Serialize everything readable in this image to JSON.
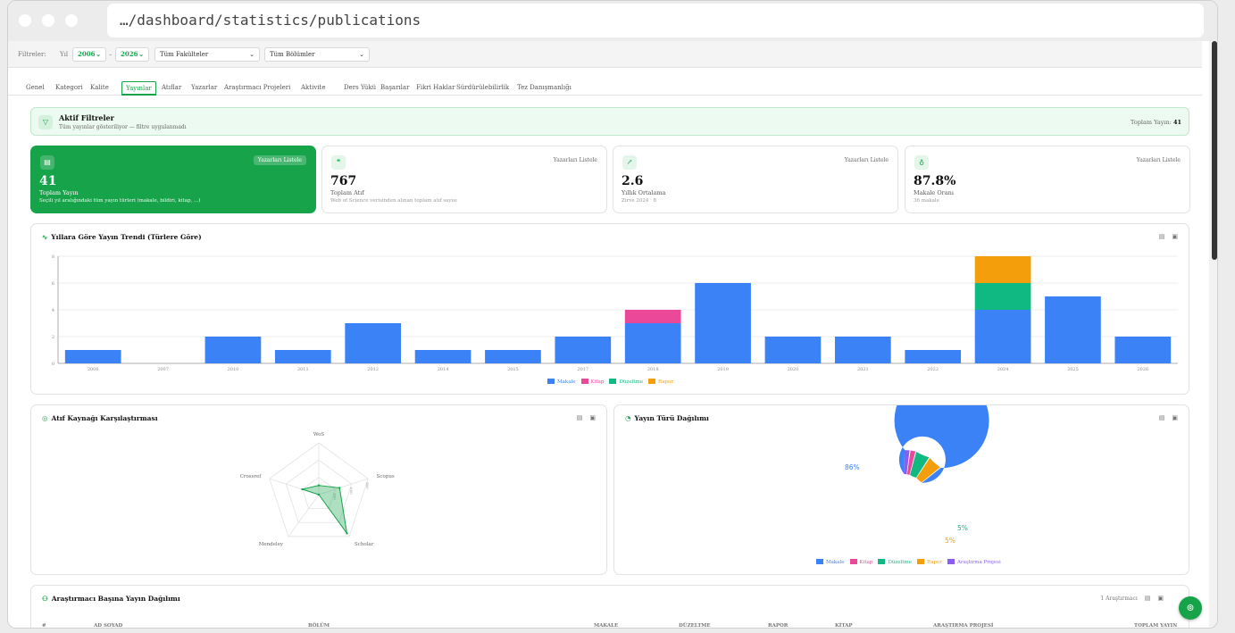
{
  "browser": {
    "url": "…/dashboard/statistics/publications"
  },
  "filters": {
    "label": "Filtreler:",
    "year_label": "Yıl",
    "year_from": "2006",
    "year_to": "2026",
    "range_sep": "–",
    "faculty": "Tüm Fakülteler",
    "department": "Tüm Bölümler"
  },
  "tabs": [
    "Genel",
    "Kategori",
    "Kalite",
    "Yayınlar",
    "Atıflar",
    "Yazarlar",
    "Araştırmacı Projeleri",
    "Aktivite",
    "Ders Yükü",
    "Başarılar",
    "Fikri Haklar",
    "Sürdürülebilirlik",
    "Tez Danışmanlığı"
  ],
  "active_tab": "Yayınlar",
  "active_filters": {
    "title": "Aktif Filtreler",
    "subtitle": "Tüm yayınlar gösteriliyor — filtre uygulanmadı",
    "total_label": "Toplam Yayın:",
    "total_value": "41"
  },
  "kpis": [
    {
      "icon": "document-icon",
      "list_label": "Yazarları Listele",
      "value": "41",
      "label": "Toplam Yayın",
      "desc": "Seçili yıl aralığındaki tüm yayın türleri (makale, bildiri, kitap, ...)"
    },
    {
      "icon": "quote-icon",
      "list_label": "Yazarları Listele",
      "value": "767",
      "label": "Toplam Atıf",
      "desc": "Web of Science verisinden alınan toplam atıf sayısı"
    },
    {
      "icon": "trend-icon",
      "list_label": "Yazarları Listele",
      "value": "2.6",
      "label": "Yıllık Ortalama",
      "desc": "Zirve 2024 · 8"
    },
    {
      "icon": "award-icon",
      "list_label": "Yazarları Listele",
      "value": "87.8%",
      "label": "Makale Oranı",
      "desc": "36 makale"
    }
  ],
  "trend_card": {
    "title": "Yıllara Göre Yayın Trendi (Türlere Göre)"
  },
  "radar_card": {
    "title": "Atıf Kaynağı Karşılaştırması"
  },
  "donut_card": {
    "title": "Yayın Türü Dağılımı"
  },
  "researcher_card": {
    "title": "Araştırmacı Başına Yayın Dağılımı",
    "count_label": "1 Araştırmacı",
    "columns": [
      "#",
      "AD SOYAD",
      "BÖLÜM",
      "MAKALE",
      "DÜZELTME",
      "RAPOR",
      "KİTAP",
      "ARAŞTIRMA PROJESİ",
      "TOPLAM YAYIN"
    ]
  },
  "colors": {
    "accent": "#16a34a",
    "makale": "#3b82f6",
    "kitap": "#ec4899",
    "duzeltme": "#10b981",
    "rapor": "#f59e0b",
    "proje": "#8b5cf6"
  },
  "chart_data": [
    {
      "type": "bar",
      "stacked": true,
      "categories": [
        "2006",
        "2007",
        "2010",
        "2011",
        "2012",
        "2014",
        "2015",
        "2017",
        "2018",
        "2019",
        "2020",
        "2021",
        "2022",
        "2024",
        "2025",
        "2026"
      ],
      "series": [
        {
          "name": "Makale",
          "color": "#3b82f6",
          "values": [
            1,
            0,
            2,
            1,
            3,
            1,
            1,
            2,
            3,
            6,
            2,
            2,
            1,
            4,
            5,
            2
          ]
        },
        {
          "name": "Kitap",
          "color": "#ec4899",
          "values": [
            0,
            0,
            0,
            0,
            0,
            0,
            0,
            0,
            1,
            0,
            0,
            0,
            0,
            0,
            0,
            0
          ]
        },
        {
          "name": "Düzeltme",
          "color": "#10b981",
          "values": [
            0,
            0,
            0,
            0,
            0,
            0,
            0,
            0,
            0,
            0,
            0,
            0,
            0,
            2,
            0,
            0
          ]
        },
        {
          "name": "Rapor",
          "color": "#f59e0b",
          "values": [
            0,
            0,
            0,
            0,
            0,
            0,
            0,
            0,
            0,
            0,
            0,
            0,
            0,
            2,
            0,
            0
          ]
        }
      ],
      "yticks": [
        "0",
        "2",
        "4",
        "6",
        "8"
      ],
      "ylim": [
        0,
        8
      ],
      "grid": true,
      "legend": "bottom"
    },
    {
      "type": "radar",
      "axes": [
        "WoS",
        "Scopus",
        "Scholar",
        "Mendeley",
        "Crossref"
      ],
      "values": [
        160,
        380,
        830,
        0,
        300
      ],
      "rmax": 900,
      "ring_labels": [
        "300",
        "600",
        "900"
      ],
      "color": "#16a34a"
    },
    {
      "type": "pie",
      "donut": true,
      "series": [
        {
          "name": "Makale",
          "value": 86,
          "color": "#3b82f6"
        },
        {
          "name": "Rapor",
          "value": 5,
          "color": "#f59e0b"
        },
        {
          "name": "Düzeltme",
          "value": 5,
          "color": "#10b981"
        },
        {
          "name": "Kitap",
          "value": 2,
          "color": "#ec4899"
        },
        {
          "name": "Araştırma Projesi",
          "value": 2,
          "color": "#8b5cf6"
        }
      ],
      "visible_labels": [
        {
          "text": "86%",
          "series": "Makale"
        },
        {
          "text": "5%",
          "series": "Düzeltme"
        },
        {
          "text": "5%",
          "series": "Rapor"
        }
      ],
      "legend": "bottom",
      "legend_order": [
        "Makale",
        "Kitap",
        "Düzeltme",
        "Rapor",
        "Araştırma Projesi"
      ]
    }
  ]
}
